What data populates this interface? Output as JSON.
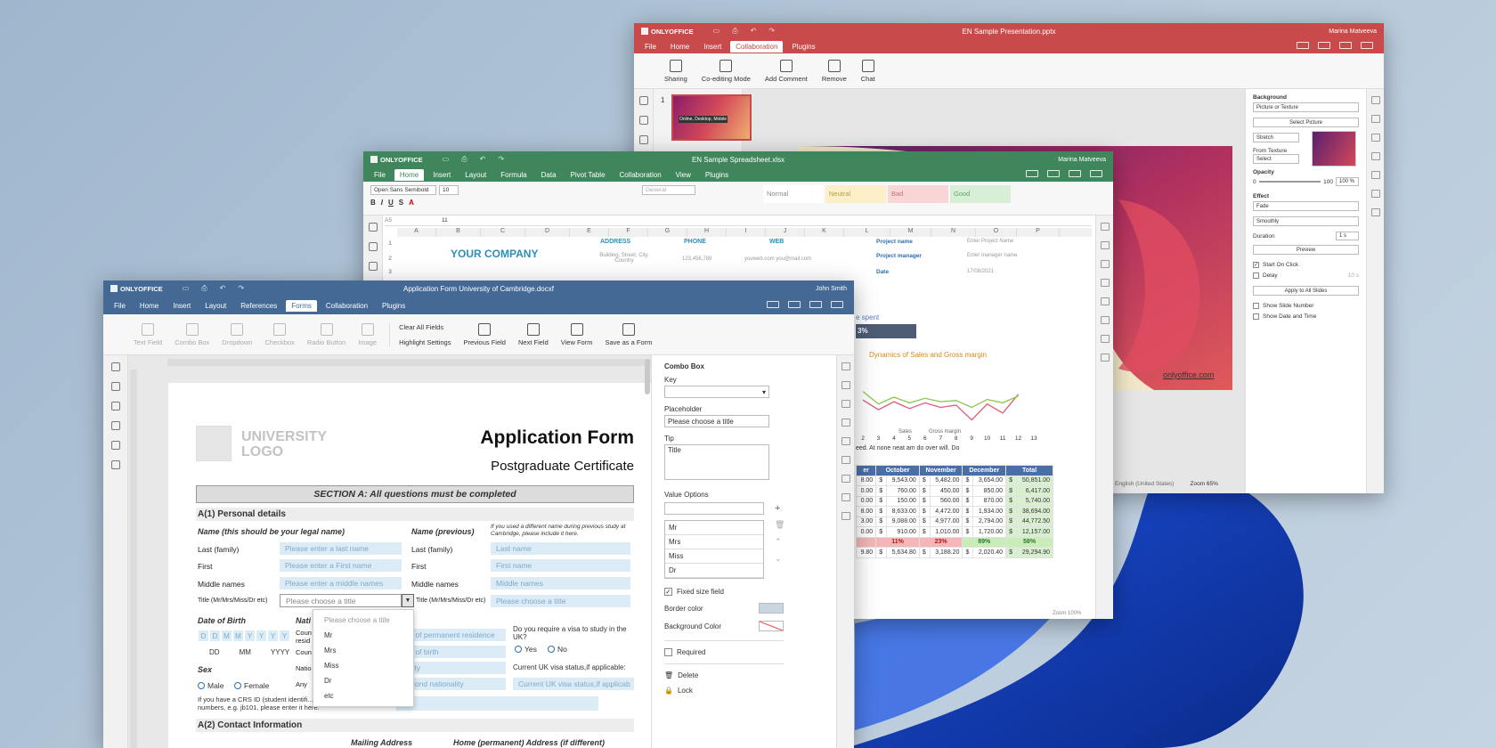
{
  "brand": "ONLYOFFICE",
  "colors": {
    "presentation": "#c94a4a",
    "spreadsheet": "#40865c",
    "document": "#446995"
  },
  "presentation": {
    "title": "EN Sample Presentation.pptx",
    "user": "Marina Matveeva",
    "menu": [
      "File",
      "Home",
      "Insert",
      "Collaboration",
      "Plugins"
    ],
    "active_menu": "Collaboration",
    "toolbar": [
      "Sharing",
      "Co-editing Mode",
      "Add Comment",
      "Remove",
      "Chat"
    ],
    "slide_number": "1",
    "thumb_text": [
      "Online,",
      "Desktop,",
      "Mobile"
    ],
    "slide_link": "onlyoffice.com",
    "panel": {
      "background_label": "Background",
      "fill_type": "Picture or Texture",
      "select_picture": "Select Picture",
      "stretch": "Stretch",
      "from_texture": "From Texture",
      "select": "Select",
      "opacity_label": "Opacity",
      "opacity_min": "0",
      "opacity_max": "100",
      "opacity_value": "100 %",
      "effect_label": "Effect",
      "effect": "Fade",
      "effect_type": "Smoothly",
      "duration_label": "Duration",
      "duration": "1 s",
      "preview": "Preview",
      "start_on_click": "Start On Click",
      "delay_label": "Delay",
      "delay": "10 s",
      "apply_all": "Apply to All Slides",
      "show_slide_number": "Show Slide Number",
      "show_date_time": "Show Date and Time"
    },
    "status": {
      "language": "English (United States)",
      "zoom": "Zoom 65%"
    }
  },
  "spreadsheet": {
    "title": "EN Sample Spreadsheet.xlsx",
    "user": "Marina Matveeva",
    "menu": [
      "File",
      "Home",
      "Insert",
      "Layout",
      "Formula",
      "Data",
      "Pivot Table",
      "Collaboration",
      "View",
      "Plugins"
    ],
    "active_menu": "Home",
    "font": "Open Sans Semibold",
    "font_size": "10",
    "number_format": "General",
    "styles": [
      "Normal",
      "Neutral",
      "Bad",
      "Good"
    ],
    "cell_ref": "A5",
    "formula": "11",
    "columns": [
      "A",
      "B",
      "C",
      "D",
      "E",
      "F",
      "G",
      "H",
      "I",
      "J",
      "K",
      "L",
      "M",
      "N",
      "O",
      "P"
    ],
    "company": "YOUR COMPANY",
    "headers": [
      "ADDRESS",
      "PHONE",
      "WEB"
    ],
    "address": "Building, Street, City, Country",
    "phone": "123,456,789",
    "web": "youweb.com you@mail.com",
    "project_name_label": "Project name",
    "project_name_ph": "Enter Project Name",
    "project_manager_label": "Project manager",
    "project_manager_ph": "Enter manager name",
    "date_label": "Date",
    "date": "17/08/2021",
    "time_spent": "e spent",
    "progress": "3%",
    "chart_title": "Dynamics of Sales and Gross margin",
    "chart_x": [
      "2",
      "3",
      "4",
      "5",
      "6",
      "7",
      "8",
      "9",
      "10",
      "11",
      "12",
      "13"
    ],
    "legend": [
      "Sales",
      "Gross margin"
    ],
    "note": "eed. At none neat am do over will. Do",
    "table": {
      "head": [
        "er",
        "October",
        "November",
        "December",
        "Total"
      ],
      "rows": [
        [
          "8.00",
          "$",
          "9,543.00",
          "$",
          "5,482.00",
          "$",
          "3,654.00",
          "$",
          "50,851.00"
        ],
        [
          "0.00",
          "$",
          "760.00",
          "$",
          "450.00",
          "$",
          "850.00",
          "$",
          "6,417.00"
        ],
        [
          "0.00",
          "$",
          "150.00",
          "$",
          "560.00",
          "$",
          "870.00",
          "$",
          "5,740.00"
        ],
        [
          "8.00",
          "$",
          "8,633.00",
          "$",
          "4,472.00",
          "$",
          "1,934.00",
          "$",
          "38,694.00"
        ],
        [
          "3.00",
          "$",
          "9,088.00",
          "$",
          "4,977.00",
          "$",
          "2,794.00",
          "$",
          "44,772.50"
        ],
        [
          "0.00",
          "$",
          "910.00",
          "$",
          "1,010.00",
          "$",
          "1,720.00",
          "$",
          "12,157.00"
        ]
      ],
      "pct": [
        "11%",
        "23%",
        "89%",
        "58%"
      ],
      "sum": [
        "9.80",
        "$",
        "5,634.80",
        "$",
        "3,188.20",
        "$",
        "2,020.40",
        "$",
        "29,294.90"
      ]
    },
    "row_numbers": [
      "1",
      "2",
      "3"
    ],
    "zoom": "Zoom 100%"
  },
  "document": {
    "title": "Application Form University of Cambridge.docxf",
    "user": "John Smith",
    "menu": [
      "File",
      "Home",
      "Insert",
      "Layout",
      "References",
      "Forms",
      "Collaboration",
      "Plugins"
    ],
    "active_menu": "Forms",
    "toolbar": [
      "Text Field",
      "Combo Box",
      "Dropdown",
      "Checkbox",
      "Radio Button",
      "Image",
      "Clear All Fields",
      "Highlight Settings",
      "Previous Field",
      "Next Field",
      "View Form",
      "Save as a Form"
    ],
    "form": {
      "logo": "UNIVERSITY LOGO",
      "heading": "Application Form",
      "subheading": "Postgraduate Certificate",
      "section_a": "SECTION A: All questions must be completed",
      "a1": "A(1) Personal details",
      "name_legal": "Name (this should be your legal name)",
      "name_prev": "Name (previous)",
      "name_prev_note": "If you used a different name during previous study at Cambridge, please include it here.",
      "last": "Last (family)",
      "first": "First",
      "middle": "Middle names",
      "title_label": "Title (Mr/Mrs/Miss/Dr etc)",
      "last_ph": "Please enter a last name",
      "first_ph": "Please enter a First name",
      "middle_ph": "Please enter a middle names",
      "title_ph": "Please choose a title",
      "last_ph2": "Last name",
      "first_ph2": "First name",
      "middle_ph2": "Middle names",
      "title_ph2": "Please choose a title",
      "dob": "Date of Birth",
      "dob_cells": [
        "D",
        "D",
        "M",
        "M",
        "Y",
        "Y",
        "Y",
        "Y"
      ],
      "dob_fmt": [
        "DD",
        "MM",
        "YYYY"
      ],
      "nat": "Nati",
      "country1": "Coun",
      "country1b": "resid",
      "country2": "Coun",
      "nationality": "Natio",
      "any": "Any",
      "perm": "ry of permanent residence",
      "birth": "ry of birth",
      "nat_f": "ality",
      "second_nat": "econd nationality",
      "visa_q": "Do you require a visa to study in the UK?",
      "yes": "Yes",
      "no": "No",
      "visa_status": "Current UK visa status,if applicable:",
      "visa_status_ph": "Current UK visa status,if applicab",
      "sex": "Sex",
      "male": "Male",
      "female": "Female",
      "crs": "If you have a CRS ID (student identifi... and several numbers, e.g. jb101, please enter it here.",
      "a2": "A(2) Contact Information",
      "mailing": "Mailing Address",
      "home_addr": "Home (permanent) Address (if different)"
    },
    "dropdown": [
      "Please choose a title",
      "Mr",
      "Mrs",
      "Miss",
      "Dr",
      "etc"
    ],
    "panel": {
      "heading": "Combo Box",
      "key": "Key",
      "placeholder_label": "Placeholder",
      "placeholder": "Please choose a title",
      "tip_label": "Tip",
      "tip": "Title",
      "value_options": "Value Options",
      "values": [
        "Mr",
        "Mrs",
        "Miss",
        "Dr"
      ],
      "fixed": "Fixed size field",
      "border_color": "Border color",
      "bg_color": "Background Color",
      "required": "Required",
      "delete": "Delete",
      "lock": "Lock"
    }
  }
}
